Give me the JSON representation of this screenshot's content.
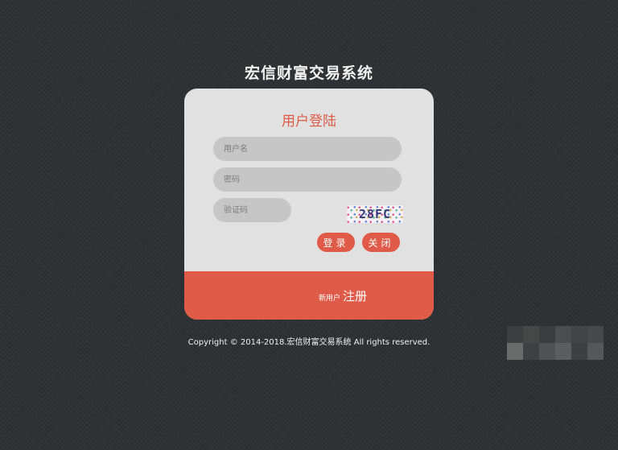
{
  "site_title": "宏信财富交易系统",
  "login": {
    "title": "用户登陆",
    "username_placeholder": "用户名",
    "password_placeholder": "密码",
    "captcha_placeholder": "验证码",
    "captcha_text": "28FC",
    "login_button": "登录",
    "close_button": "关闭"
  },
  "register": {
    "prefix": "新用户",
    "link": "注册"
  },
  "copyright": "Copyright © 2014-2018.宏信财富交易系统 All rights reserved.",
  "colors": {
    "accent": "#e05a48",
    "card": "#e1e1e1",
    "background": "#2f3234"
  }
}
